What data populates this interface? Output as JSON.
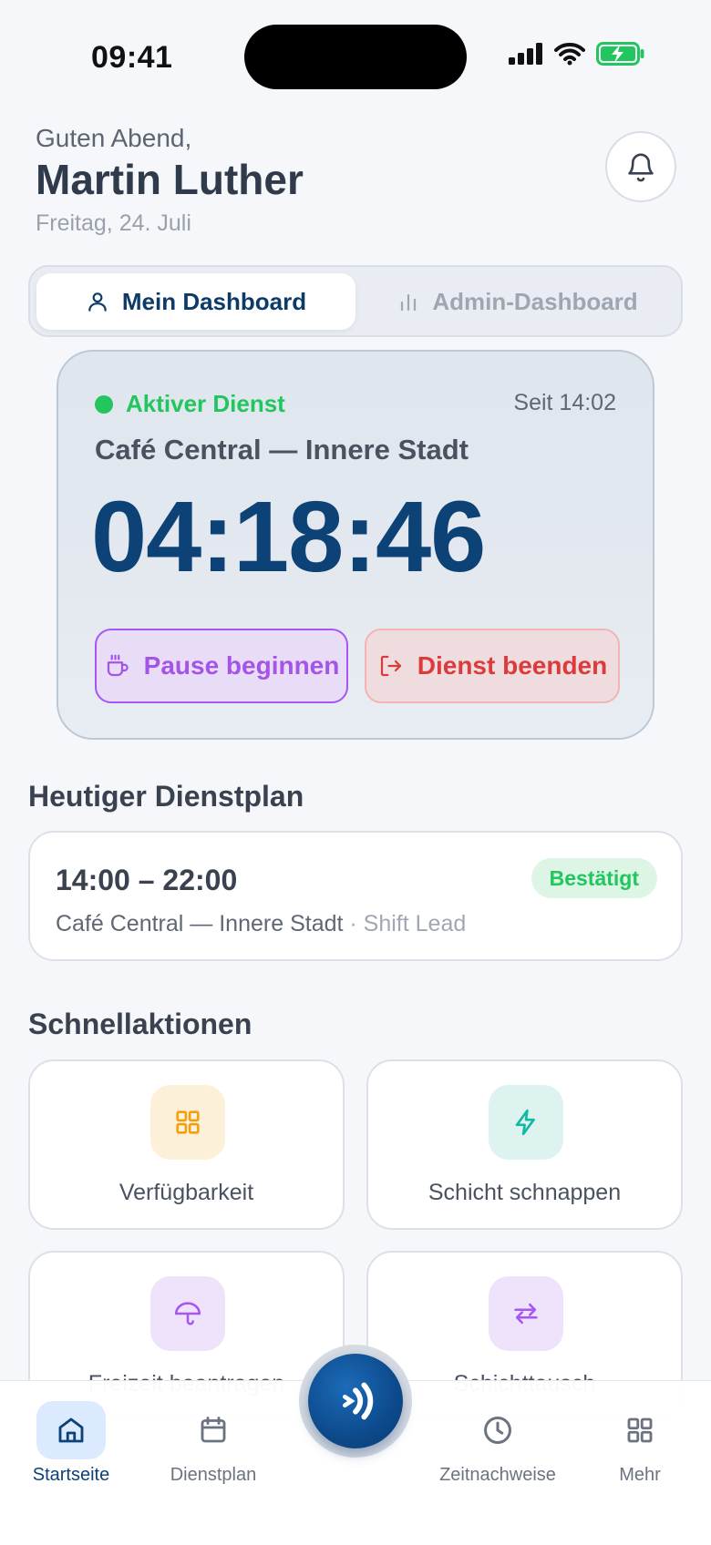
{
  "status_bar": {
    "time": "09:41"
  },
  "header": {
    "greeting": "Guten Abend,",
    "name": "Martin Luther",
    "date": "Freitag, 24. Juli"
  },
  "segmented": {
    "my_dashboard": "Mein Dashboard",
    "admin_dashboard": "Admin-Dashboard",
    "selected": "my_dashboard"
  },
  "active_shift": {
    "status": "Aktiver Dienst",
    "since": "Seit 14:02",
    "location": "Café Central — Innere Stadt",
    "timer": "04:18:46",
    "pause_label": "Pause beginnen",
    "end_label": "Dienst beenden"
  },
  "schedule": {
    "title": "Heutiger Dienstplan",
    "time_range": "14:00 – 22:00",
    "badge": "Bestätigt",
    "location": "Café Central — Innere Stadt",
    "role": "· Shift Lead"
  },
  "quick_actions": {
    "title": "Schnellaktionen",
    "items": [
      {
        "label": "Verfügbarkeit",
        "icon": "grid-icon",
        "color": "#f59e0b"
      },
      {
        "label": "Schicht schnappen",
        "icon": "lightning-icon",
        "color": "#14b8a6"
      },
      {
        "label": "Freizeit beantragen",
        "icon": "umbrella-icon",
        "color": "#a855f7"
      },
      {
        "label": "Schichttausch",
        "icon": "swap-icon",
        "color": "#a855f7"
      }
    ]
  },
  "tab_bar": {
    "home": "Startseite",
    "schedule": "Dienstplan",
    "timesheets": "Zeitnachweise",
    "more": "Mehr",
    "active": "home"
  },
  "colors": {
    "brand": "#0d4277",
    "success": "#22c55e",
    "pause": "#a855f7",
    "danger": "#dc3b3b"
  }
}
